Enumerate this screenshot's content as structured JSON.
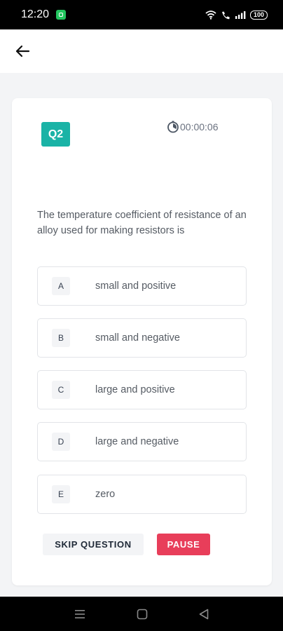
{
  "status_bar": {
    "time": "12:20",
    "battery": "100"
  },
  "header": {
    "back_icon": "arrow-left-icon"
  },
  "quiz": {
    "question_number": "Q2",
    "timer": "00:00:06",
    "timer_icon": "stopwatch-icon",
    "question_text": "The temperature coefficient of resistance of an alloy used for making resistors is",
    "options": [
      {
        "letter": "A",
        "text": "small and positive"
      },
      {
        "letter": "B",
        "text": "small and negative"
      },
      {
        "letter": "C",
        "text": "large and positive"
      },
      {
        "letter": "D",
        "text": "large and negative"
      },
      {
        "letter": "E",
        "text": "zero"
      }
    ],
    "skip_label": "SKIP QUESTION",
    "pause_label": "PAUSE"
  },
  "colors": {
    "badge": "#1ab3a6",
    "pause": "#e83e5a"
  }
}
